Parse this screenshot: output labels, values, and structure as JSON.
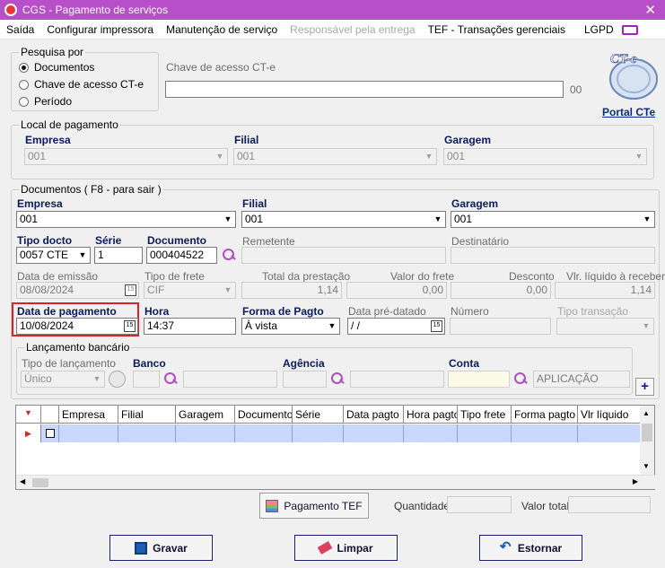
{
  "window": {
    "title": "CGS - Pagamento de serviços"
  },
  "menu": [
    "Saída",
    "Configurar impressora",
    "Manutenção de serviço",
    "Responsável pela entrega",
    "TEF - Transações gerenciais",
    "LGPD"
  ],
  "pesquisa": {
    "legend": "Pesquisa por",
    "options": [
      "Documentos",
      "Chave de acesso CT-e",
      "Período"
    ],
    "selected": "Documentos",
    "chave_label": "Chave de acesso CT-e",
    "chave_value": "",
    "chave_suffix": "00",
    "logo_text": "CT-e",
    "portal_link": "Portal CTe"
  },
  "local": {
    "legend": "Local de pagamento",
    "empresa_label": "Empresa",
    "empresa_value": "001",
    "filial_label": "Filial",
    "filial_value": "001",
    "garagem_label": "Garagem",
    "garagem_value": "001"
  },
  "documentos": {
    "legend": "Documentos ( F8 - para sair )",
    "empresa_label": "Empresa",
    "empresa_value": "001",
    "filial_label": "Filial",
    "filial_value": "001",
    "garagem_label": "Garagem",
    "garagem_value": "001",
    "tipo_docto_label": "Tipo docto",
    "tipo_docto_value": "0057 CTE",
    "serie_label": "Série",
    "serie_value": "1",
    "documento_label": "Documento",
    "documento_value": "000404522",
    "remetente_label": "Remetente",
    "remetente_value": "",
    "destinatario_label": "Destinatário",
    "destinatario_value": "",
    "data_emissao_label": "Data de emissão",
    "data_emissao_value": "08/08/2024",
    "tipo_frete_label": "Tipo de frete",
    "tipo_frete_value": "CIF",
    "total_prestacao_label": "Total da prestação",
    "total_prestacao_value": "1,14",
    "valor_frete_label": "Valor do frete",
    "valor_frete_value": "0,00",
    "desconto_label": "Desconto",
    "desconto_value": "0,00",
    "vlr_liquido_label": "Vlr. líquido à receber",
    "vlr_liquido_value": "1,14",
    "data_pagamento_label": "Data de pagamento",
    "data_pagamento_value": "10/08/2024",
    "hora_label": "Hora",
    "hora_value": "14:37",
    "forma_pagto_label": "Forma de Pagto",
    "forma_pagto_value": "À vista",
    "data_predatado_label": "Data pré-datado",
    "data_predatado_value": " /  /",
    "numero_label": "Número",
    "numero_value": "",
    "tipo_transacao_label": "Tipo transação",
    "tipo_transacao_value": "",
    "cal_icon": "15"
  },
  "bancario": {
    "legend": "Lançamento bancário",
    "tipo_label": "Tipo de lançamento",
    "tipo_value": "Único",
    "banco_label": "Banco",
    "banco_value": "",
    "agencia_label": "Agência",
    "agencia_value": "",
    "conta_label": "Conta",
    "conta_value": "",
    "conta_desc": "APLICAÇÃO",
    "add_label": "+"
  },
  "grid": {
    "columns": [
      "Empresa",
      "Filial",
      "Garagem",
      "Documento",
      "Série",
      "Data pagto",
      "Hora pagto",
      "Tipo frete",
      "Forma pagto",
      "Vlr líquido"
    ]
  },
  "footer": {
    "pagamento_tef": "Pagamento TEF",
    "quantidade_label": "Quantidade",
    "quantidade_value": "",
    "valor_total_label": "Valor total",
    "valor_total_value": "",
    "gravar": "Gravar",
    "limpar": "Limpar",
    "estornar": "Estornar"
  },
  "colors": {
    "titlebar": "#b64fc8",
    "accent": "#b04fc0",
    "highlight": "#dd2222",
    "selection": "#c9d8ff"
  }
}
